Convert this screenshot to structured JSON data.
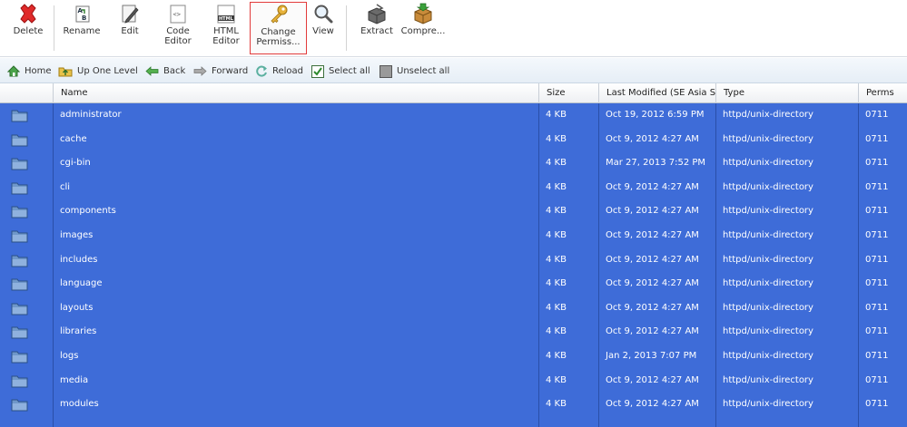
{
  "toolbar": {
    "buttons": [
      {
        "label": "Delete",
        "icon": "delete-icon"
      },
      {
        "label": "Rename",
        "icon": "rename-icon"
      },
      {
        "label": "Edit",
        "icon": "edit-icon"
      },
      {
        "label": "Code Editor",
        "icon": "code-editor-icon"
      },
      {
        "label": "HTML Editor",
        "icon": "html-editor-icon"
      },
      {
        "label": "Change Permiss...",
        "icon": "key-icon"
      },
      {
        "label": "View",
        "icon": "magnifier-icon"
      },
      {
        "label": "Extract",
        "icon": "extract-icon"
      },
      {
        "label": "Compre...",
        "icon": "compress-icon"
      }
    ]
  },
  "nav": {
    "home": "Home",
    "up": "Up One Level",
    "back": "Back",
    "forward": "Forward",
    "reload": "Reload",
    "select_all": "Select all",
    "unselect_all": "Unselect all"
  },
  "columns": {
    "name": "Name",
    "size": "Size",
    "modified": "Last Modified (SE Asia S",
    "type": "Type",
    "perms": "Perms"
  },
  "colors": {
    "selection": "#3e6cd8",
    "active_border": "#e23b3b"
  },
  "rows": [
    {
      "name": "administrator",
      "size": "4 KB",
      "modified": "Oct 19, 2012 6:59 PM",
      "type": "httpd/unix-directory",
      "perms": "0711"
    },
    {
      "name": "cache",
      "size": "4 KB",
      "modified": "Oct 9, 2012 4:27 AM",
      "type": "httpd/unix-directory",
      "perms": "0711"
    },
    {
      "name": "cgi-bin",
      "size": "4 KB",
      "modified": "Mar 27, 2013 7:52 PM",
      "type": "httpd/unix-directory",
      "perms": "0711"
    },
    {
      "name": "cli",
      "size": "4 KB",
      "modified": "Oct 9, 2012 4:27 AM",
      "type": "httpd/unix-directory",
      "perms": "0711"
    },
    {
      "name": "components",
      "size": "4 KB",
      "modified": "Oct 9, 2012 4:27 AM",
      "type": "httpd/unix-directory",
      "perms": "0711"
    },
    {
      "name": "images",
      "size": "4 KB",
      "modified": "Oct 9, 2012 4:27 AM",
      "type": "httpd/unix-directory",
      "perms": "0711"
    },
    {
      "name": "includes",
      "size": "4 KB",
      "modified": "Oct 9, 2012 4:27 AM",
      "type": "httpd/unix-directory",
      "perms": "0711"
    },
    {
      "name": "language",
      "size": "4 KB",
      "modified": "Oct 9, 2012 4:27 AM",
      "type": "httpd/unix-directory",
      "perms": "0711"
    },
    {
      "name": "layouts",
      "size": "4 KB",
      "modified": "Oct 9, 2012 4:27 AM",
      "type": "httpd/unix-directory",
      "perms": "0711"
    },
    {
      "name": "libraries",
      "size": "4 KB",
      "modified": "Oct 9, 2012 4:27 AM",
      "type": "httpd/unix-directory",
      "perms": "0711"
    },
    {
      "name": "logs",
      "size": "4 KB",
      "modified": "Jan 2, 2013 7:07 PM",
      "type": "httpd/unix-directory",
      "perms": "0711"
    },
    {
      "name": "media",
      "size": "4 KB",
      "modified": "Oct 9, 2012 4:27 AM",
      "type": "httpd/unix-directory",
      "perms": "0711"
    },
    {
      "name": "modules",
      "size": "4 KB",
      "modified": "Oct 9, 2012 4:27 AM",
      "type": "httpd/unix-directory",
      "perms": "0711"
    }
  ]
}
